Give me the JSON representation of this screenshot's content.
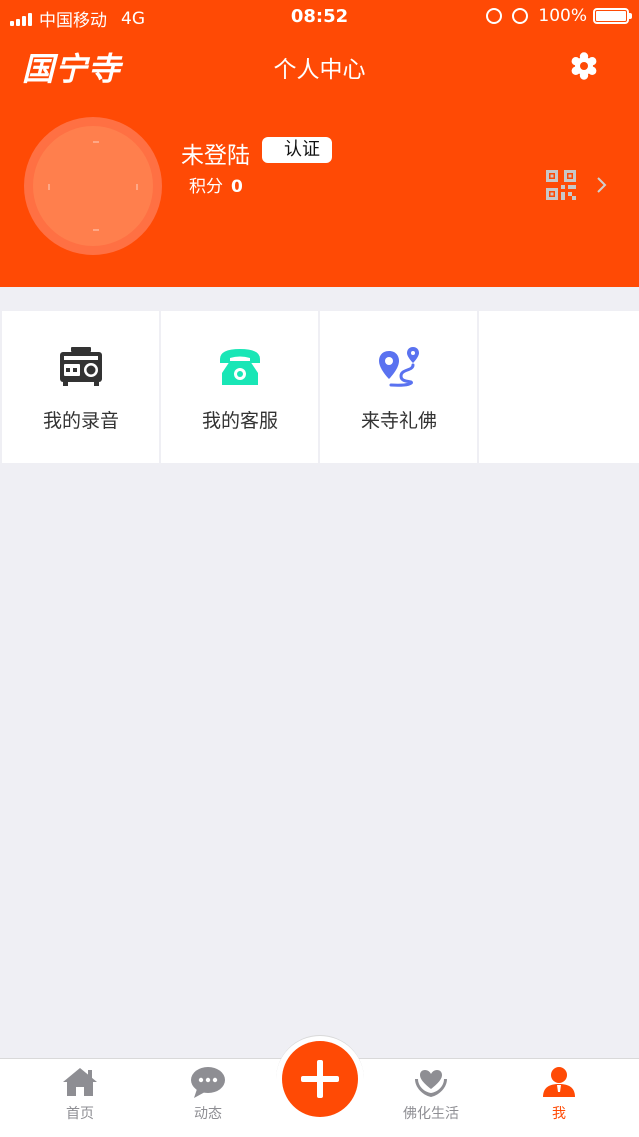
{
  "status_bar": {
    "carrier": "中国移动",
    "network": "4G",
    "time": "08:52",
    "battery": "100%"
  },
  "header": {
    "logo": "国宁寺",
    "title": "个人中心",
    "settings_icon": "gear-icon"
  },
  "profile": {
    "username": "未登陆",
    "verify_label": "认证",
    "points_label": "积分",
    "points_value": "0",
    "qr_icon": "qr-code-icon"
  },
  "menu": [
    {
      "label": "我的录音",
      "icon": "radio-recorder-icon",
      "color": "#333333"
    },
    {
      "label": "我的客服",
      "icon": "telephone-icon",
      "color": "#19e6b6"
    },
    {
      "label": "来寺礼佛",
      "icon": "map-route-icon",
      "color": "#5a72f0"
    }
  ],
  "tabbar": {
    "items": [
      {
        "label": "首页",
        "icon": "home-icon"
      },
      {
        "label": "动态",
        "icon": "chat-bubble-icon"
      },
      {
        "label": "佛化生活",
        "icon": "heart-hands-icon"
      },
      {
        "label": "我",
        "icon": "user-icon"
      }
    ],
    "active_index": 3,
    "accent": "#ff4a05"
  }
}
